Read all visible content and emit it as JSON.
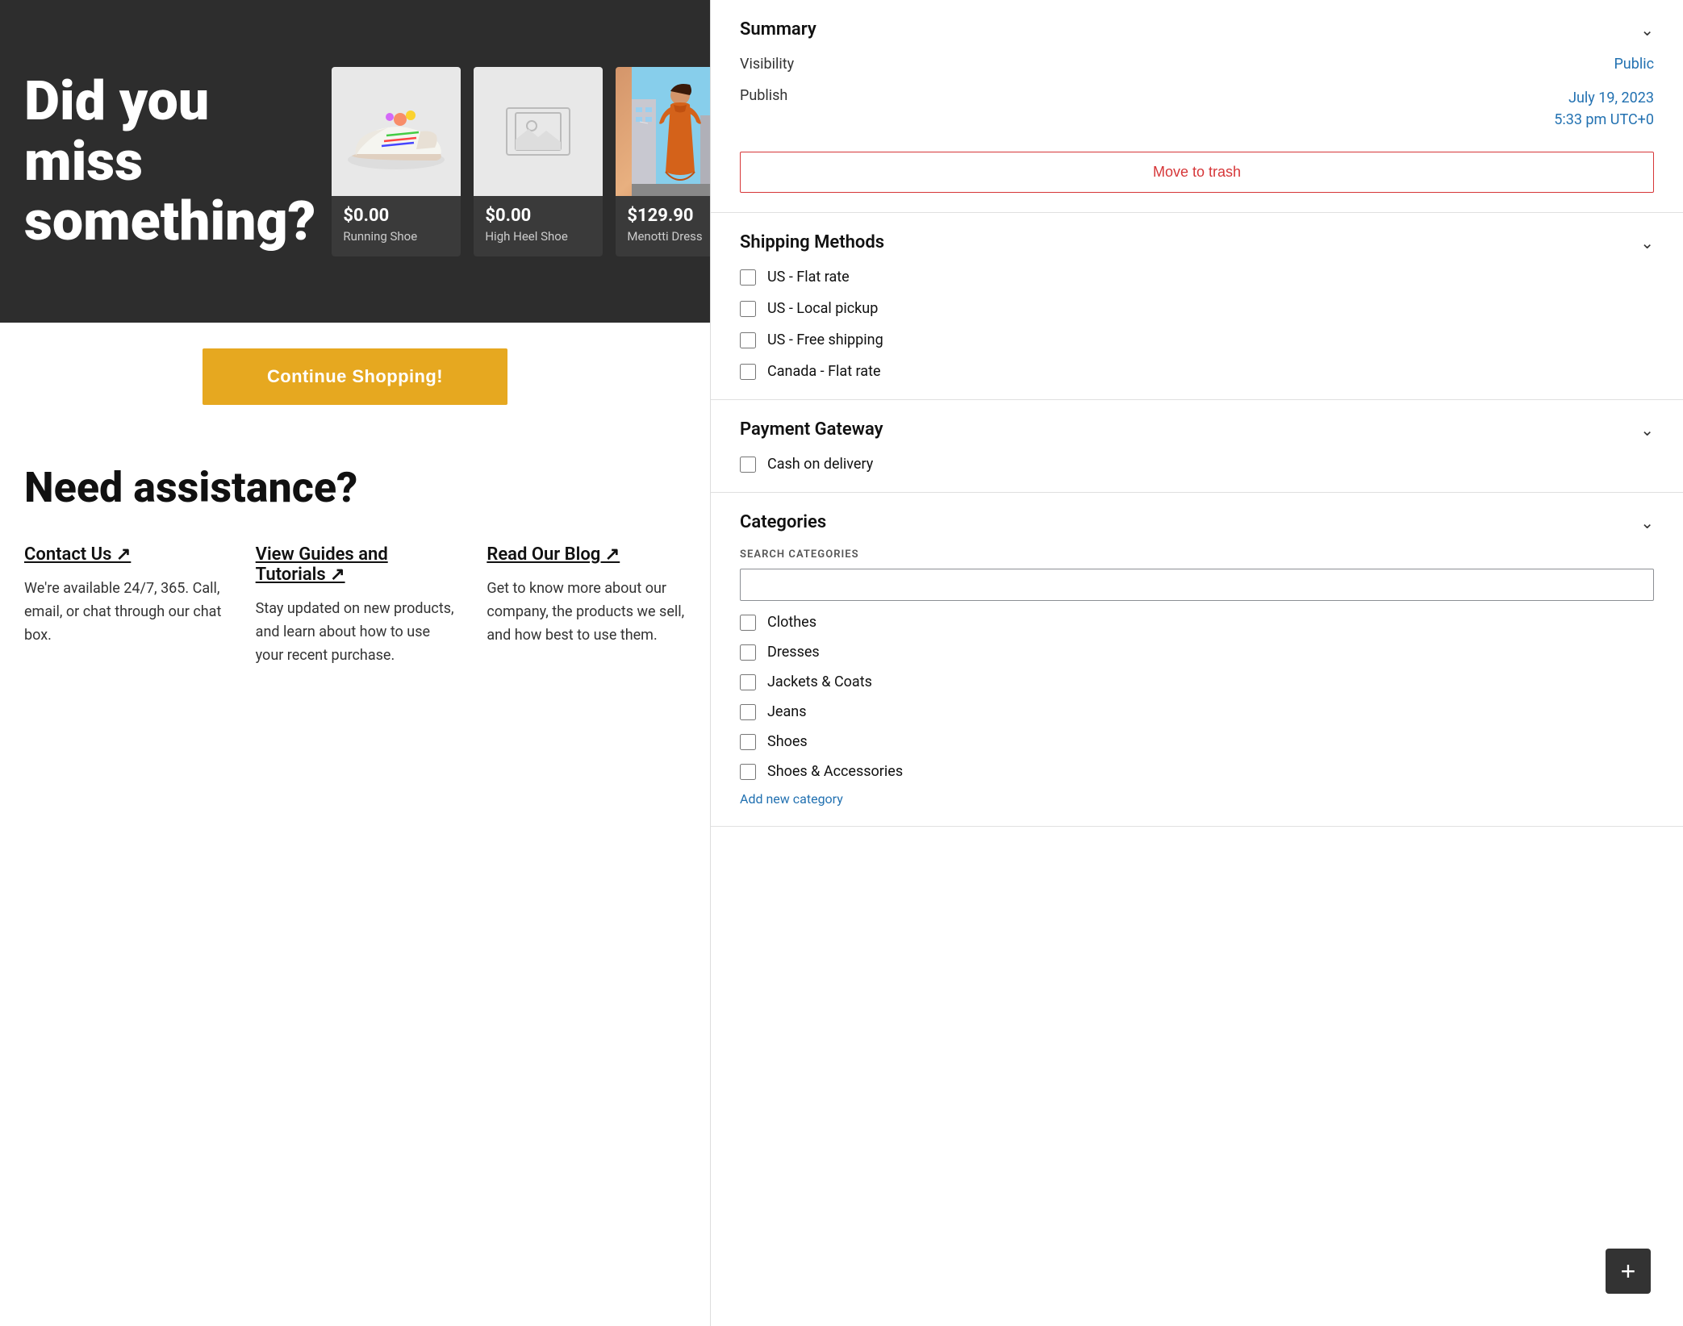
{
  "hero": {
    "headline": "Did you miss something?",
    "products": [
      {
        "price": "$0.00",
        "name": "Running Shoe",
        "type": "shoe"
      },
      {
        "price": "$0.00",
        "name": "High Heel Shoe",
        "type": "placeholder"
      },
      {
        "price": "$129.90",
        "name": "Menotti Dress",
        "type": "dress"
      }
    ]
  },
  "continue_button": "Continue Shopping!",
  "assistance": {
    "title": "Need assistance?",
    "items": [
      {
        "link_text": "Contact Us ↗",
        "description": "We're available 24/7, 365. Call, email, or chat through our chat box."
      },
      {
        "link_text": "View Guides and Tutorials ↗",
        "description": "Stay updated on new products, and learn about how to use your recent purchase."
      },
      {
        "link_text": "Read Our Blog ↗",
        "description": "Get to know more about our company, the products we sell, and how best to use them."
      }
    ]
  },
  "summary": {
    "title": "Summary",
    "visibility_label": "Visibility",
    "visibility_value": "Public",
    "publish_label": "Publish",
    "publish_date": "July 19, 2023",
    "publish_time": "5:33 pm UTC+0",
    "trash_button": "Move to trash"
  },
  "shipping_methods": {
    "title": "Shipping Methods",
    "options": [
      "US - Flat rate",
      "US - Local pickup",
      "US - Free shipping",
      "Canada - Flat rate"
    ]
  },
  "payment_gateway": {
    "title": "Payment Gateway",
    "options": [
      "Cash on delivery"
    ]
  },
  "categories": {
    "title": "Categories",
    "search_label": "SEARCH CATEGORIES",
    "search_placeholder": "",
    "items": [
      "Clothes",
      "Dresses",
      "Jackets & Coats",
      "Jeans",
      "Shoes",
      "Shoes & Accessories"
    ],
    "add_link": "Add new category"
  },
  "fab_icon": "+"
}
